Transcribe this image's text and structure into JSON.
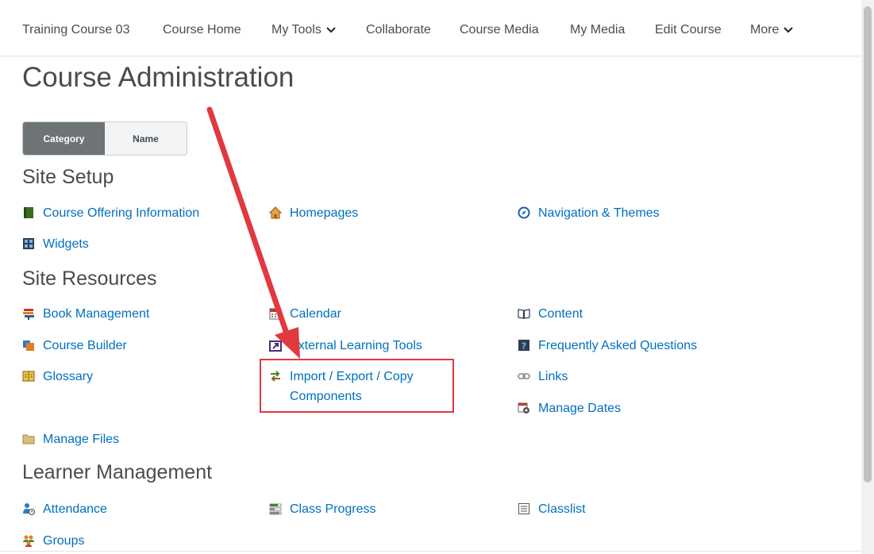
{
  "nav": {
    "items": [
      {
        "label": "Training Course 03"
      },
      {
        "label": "Course Home"
      },
      {
        "label": "My Tools"
      },
      {
        "label": "Collaborate"
      },
      {
        "label": "Course Media"
      },
      {
        "label": "My Media"
      },
      {
        "label": "Edit Course"
      },
      {
        "label": "More"
      }
    ]
  },
  "page": {
    "title": "Course Administration"
  },
  "toggle": {
    "category": "Category",
    "name": "Name",
    "selected": "Category"
  },
  "sections": {
    "site_setup": {
      "title": "Site Setup",
      "links": [
        "Course Offering Information",
        "Homepages",
        "Navigation & Themes",
        "Widgets"
      ]
    },
    "site_resources": {
      "title": "Site Resources",
      "links": [
        "Book Management",
        "Calendar",
        "Content",
        "Course Builder",
        "External Learning Tools",
        "Frequently Asked Questions",
        "Glossary",
        "Import / Export / Copy",
        "Components",
        "Links",
        "Manage Dates",
        "Manage Files"
      ]
    },
    "learner_management": {
      "title": "Learner Management",
      "links": [
        "Attendance",
        "Class Progress",
        "Classlist",
        "Groups"
      ]
    }
  },
  "colors": {
    "link": "#006fbf",
    "annotation": "#e0393e",
    "text": "#494c4e"
  },
  "annotation": {
    "type": "arrow",
    "target": "Import / Export / Copy Components"
  }
}
